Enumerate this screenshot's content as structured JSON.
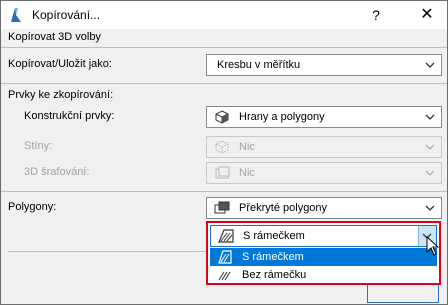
{
  "window": {
    "title": "Kopírování...",
    "help": "?",
    "close": "✕"
  },
  "section_header": "Kopírovat 3D volby",
  "copy_save": {
    "label": "Kopírovat/Uložit jako:",
    "value": "Kresbu v měřítku"
  },
  "elements_to_copy": {
    "label": "Prvky ke zkopírování:"
  },
  "construction": {
    "label": "Konstrukční prvky:",
    "value": "Hrany a polygony"
  },
  "shadows": {
    "label": "Stíny:",
    "value": "Nic"
  },
  "hatching": {
    "label": "3D šrafování:",
    "value": "Nic"
  },
  "polygons": {
    "label": "Polygony:",
    "value": "Překryté polygony"
  },
  "dropdown": {
    "current": "S rámečkem",
    "options": [
      {
        "label": "S rámečkem",
        "selected": true
      },
      {
        "label": "Bez rámečku",
        "selected": false
      }
    ],
    "highlight_color": "#0078d7",
    "outline_color": "#e0001b"
  }
}
